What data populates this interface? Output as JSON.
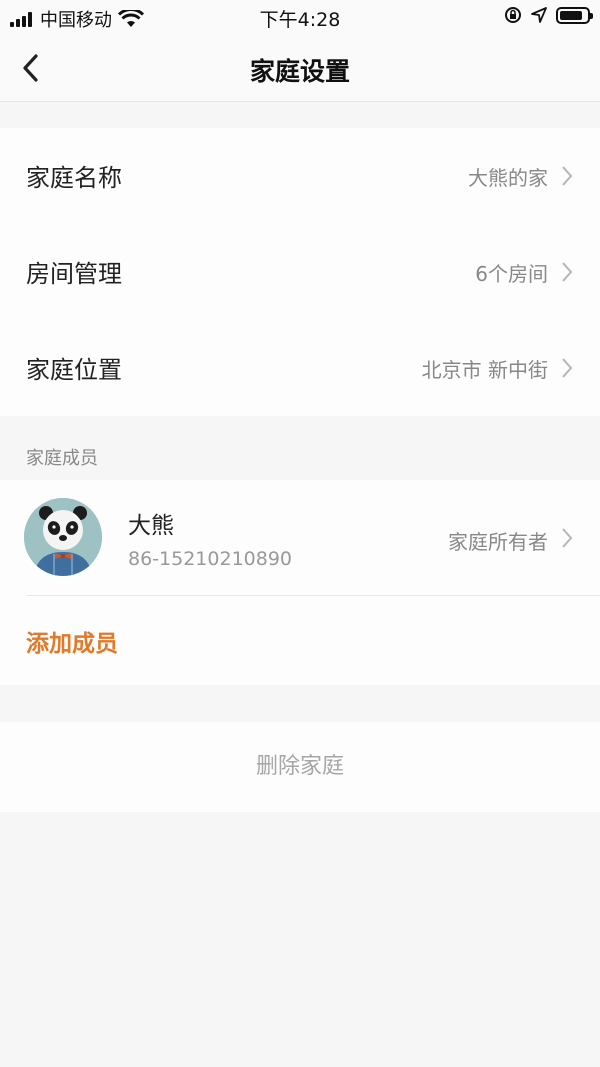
{
  "status_bar": {
    "carrier": "中国移动",
    "time": "下午4:28"
  },
  "nav": {
    "title": "家庭设置"
  },
  "settings": [
    {
      "label": "家庭名称",
      "value": "大熊的家"
    },
    {
      "label": "房间管理",
      "value": "6个房间"
    },
    {
      "label": "家庭位置",
      "value": "北京市 新中街"
    }
  ],
  "members_section": {
    "label": "家庭成员",
    "members": [
      {
        "name": "大熊",
        "phone": "86-15210210890",
        "role": "家庭所有者"
      }
    ],
    "add_label": "添加成员"
  },
  "delete_label": "删除家庭",
  "colors": {
    "accent": "#e07a2a",
    "background": "#f6f6f6",
    "card": "#fdfdfd",
    "secondary_text": "#888888"
  }
}
